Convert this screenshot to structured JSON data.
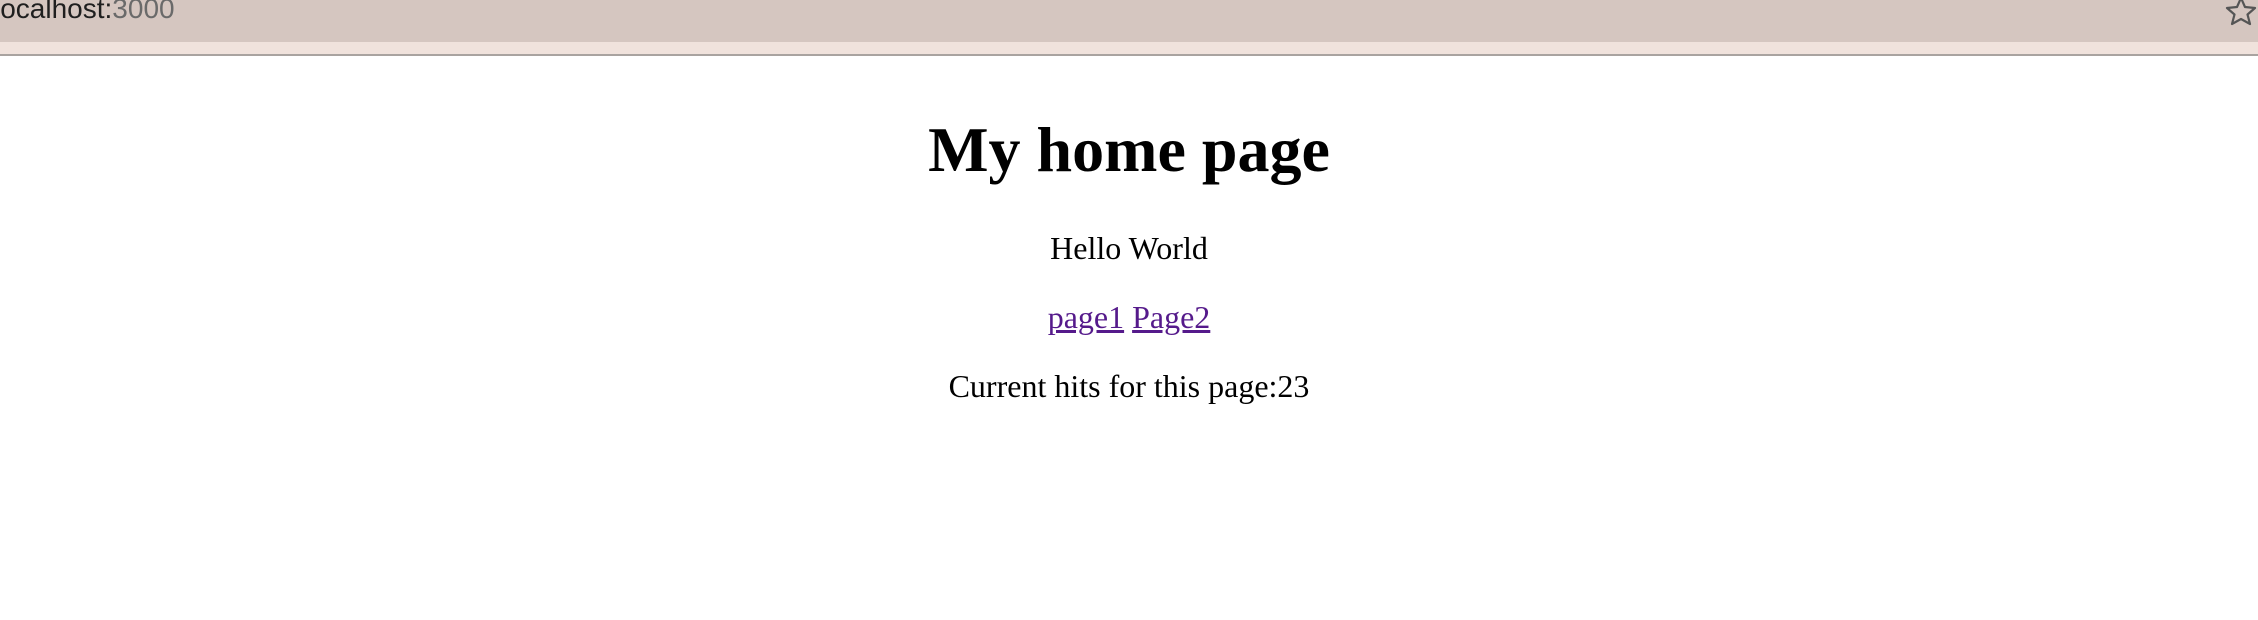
{
  "browser": {
    "url_host": "localhost:",
    "url_port": "3000",
    "bookmark_icon": "star-icon"
  },
  "page": {
    "title": "My home page",
    "greeting": "Hello World",
    "links": [
      {
        "label": "page1"
      },
      {
        "label": "Page2"
      }
    ],
    "hits_label": "Current hits for this page:",
    "hits_count": "23"
  },
  "colors": {
    "toolbar": "#d5c6c0",
    "link_visited": "#551a8b"
  }
}
